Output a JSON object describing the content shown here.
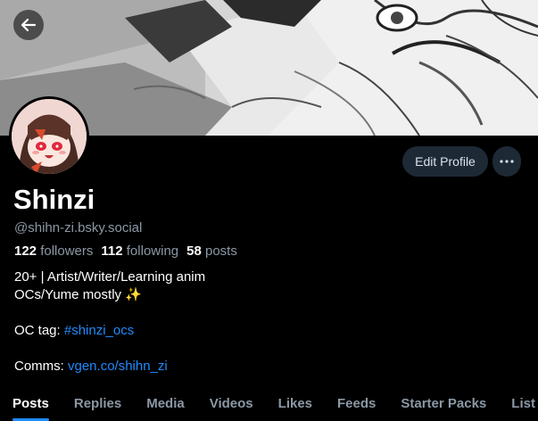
{
  "profile": {
    "display_name": "Shinzi",
    "handle": "@shihn-zi.bsky.social",
    "followers_count": "122",
    "followers_label": "followers",
    "following_count": "112",
    "following_label": "following",
    "posts_count": "58",
    "posts_label": "posts"
  },
  "actions": {
    "edit_profile_label": "Edit Profile",
    "more_label": "···"
  },
  "bio": {
    "line1": "20+ | Artist/Writer/Learning anim",
    "line2": "OCs/Yume mostly ✨",
    "oc_tag_prefix": "OC tag: ",
    "oc_tag_link": "#shinzi_ocs",
    "comms_prefix": "Comms: ",
    "comms_link": "vgen.co/shihn_zi"
  },
  "tabs": [
    {
      "label": "Posts",
      "active": true
    },
    {
      "label": "Replies"
    },
    {
      "label": "Media"
    },
    {
      "label": "Videos"
    },
    {
      "label": "Likes"
    },
    {
      "label": "Feeds"
    },
    {
      "label": "Starter Packs"
    },
    {
      "label": "List"
    }
  ],
  "colors": {
    "background": "#000000",
    "accent_link": "#208bfe",
    "muted_text": "#8b98a5",
    "button_bg": "#1e2936"
  },
  "icons": {
    "back": "arrow-left-icon",
    "more": "ellipsis-icon"
  }
}
